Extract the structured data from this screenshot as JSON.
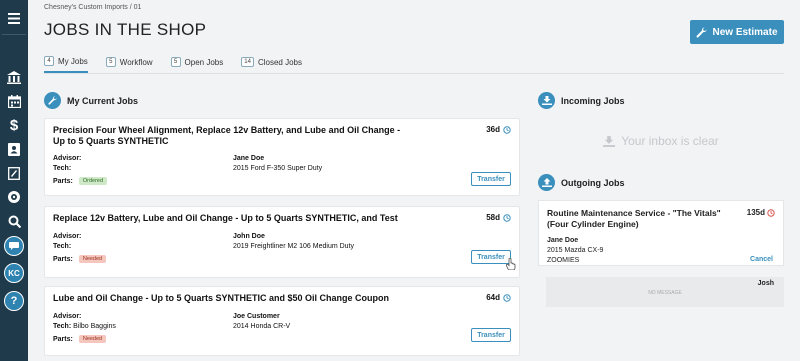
{
  "sidebar": {
    "items": [
      {
        "icon": "menu-icon"
      },
      {
        "icon": "shop-icon"
      },
      {
        "icon": "calendar-icon"
      },
      {
        "icon": "dollar-icon"
      },
      {
        "icon": "address-book-icon"
      },
      {
        "icon": "estimate-icon"
      },
      {
        "icon": "tire-icon"
      },
      {
        "icon": "search-icon"
      },
      {
        "icon": "chat-icon"
      },
      {
        "icon": "user-avatar"
      },
      {
        "icon": "help-icon"
      }
    ],
    "avatar_initials": "KC",
    "help_glyph": "?"
  },
  "header": {
    "breadcrumb": "Chesney's Custom Imports / 01",
    "title": "JOBS IN THE SHOP",
    "new_estimate_label": "New Estimate"
  },
  "tabs": [
    {
      "count": "4",
      "label": "My Jobs",
      "active": true
    },
    {
      "count": "5",
      "label": "Workflow",
      "active": false
    },
    {
      "count": "5",
      "label": "Open Jobs",
      "active": false
    },
    {
      "count": "14",
      "label": "Closed Jobs",
      "active": false
    }
  ],
  "my_jobs": {
    "heading": "My Current Jobs",
    "labels": {
      "advisor": "Advisor:",
      "tech": "Tech:",
      "parts": "Parts:",
      "transfer": "Transfer"
    },
    "jobs": [
      {
        "title": "Precision Four Wheel Alignment, Replace 12v Battery, and Lube and Oil Change - Up to 5 Quarts SYNTHETIC",
        "age": "36d",
        "advisor_name": "Jane Doe",
        "tech_name": "",
        "vehicle": "2015 Ford F-350 Super Duty",
        "parts_status": "Ordered"
      },
      {
        "title": "Replace 12v Battery, Lube and Oil Change - Up to 5 Quarts SYNTHETIC, and Test",
        "age": "58d",
        "advisor_name": "John Doe",
        "tech_name": "",
        "vehicle": "2019 Freightliner M2 106 Medium Duty",
        "parts_status": "Needed"
      },
      {
        "title": "Lube and Oil Change - Up to 5 Quarts SYNTHETIC and $50 Oil Change Coupon",
        "age": "64d",
        "advisor_name": "Joe Customer",
        "tech_name": "Bilbo Baggins",
        "vehicle": "2014 Honda CR-V",
        "parts_status": "Needed"
      }
    ]
  },
  "incoming": {
    "heading": "Incoming Jobs",
    "empty_text": "Your inbox is clear"
  },
  "outgoing": {
    "heading": "Outgoing Jobs",
    "job": {
      "title": "Routine Maintenance Service - \"The Vitals\" (Four Cylinder Engine)",
      "age": "135d",
      "customer": "Jane Doe",
      "vehicle": "2015 Mazda CX-9",
      "nickname": "ZOOMIES",
      "cancel_label": "Cancel"
    },
    "message": {
      "from": "Josh",
      "text": "NO MESSAGE"
    }
  },
  "colors": {
    "accent": "#3a8fbc",
    "sidebar": "#1f3a4b",
    "ordered": "#cfe9c8",
    "needed": "#f4c6bd"
  }
}
